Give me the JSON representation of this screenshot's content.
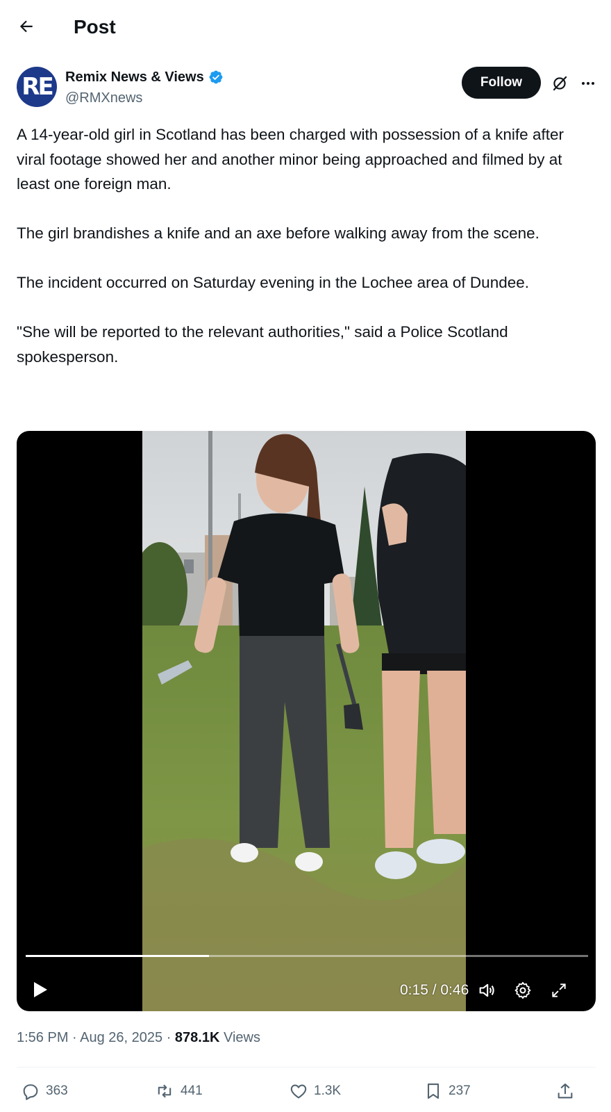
{
  "header": {
    "title": "Post"
  },
  "author": {
    "avatar_text": "RE",
    "name": "Remix News & Views",
    "handle": "@RMXnews",
    "follow_label": "Follow"
  },
  "post": {
    "paragraphs": [
      "A 14-year-old girl in Scotland has been charged with possession of a knife after viral footage showed her and another minor being approached and filmed by at least one foreign man.",
      "The girl brandishes a knife and an axe before walking away from the scene.",
      "The incident occurred on Saturday evening in the Lochee area of Dundee.",
      "\"She will be reported to the relevant authorities,\" said a Police Scotland spokesperson."
    ]
  },
  "video": {
    "time_display": "0:15 / 0:46",
    "progress_fraction": 0.326
  },
  "meta": {
    "timestamp": "1:56 PM · Aug 26, 2025 · ",
    "views_count": "878.1K",
    "views_label": " Views"
  },
  "actions": {
    "replies": "363",
    "reposts": "441",
    "likes": "1.3K",
    "bookmarks": "237"
  },
  "colors": {
    "text_primary": "#0f1419",
    "text_secondary": "#536471",
    "verified_blue": "#1d9bf0",
    "avatar_bg": "#1d3a8a"
  }
}
